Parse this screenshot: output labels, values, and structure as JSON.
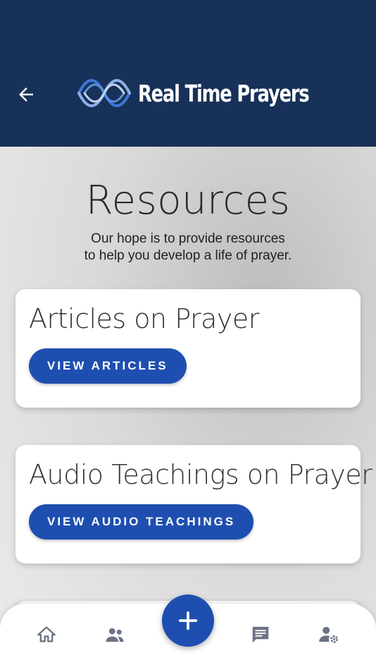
{
  "header": {
    "app_name": "Real Time Prayers",
    "back_icon": "arrow-left-icon",
    "logo_icon": "wave-logo-icon",
    "background_color": "#183158"
  },
  "page": {
    "title": "Resources",
    "subtitle_line1": "Our hope is to provide resources",
    "subtitle_line2": "to help you develop a life of prayer."
  },
  "cards": [
    {
      "title": "Articles on Prayer",
      "button_label": "VIEW ARTICLES"
    },
    {
      "title": "Audio Teachings on Prayer",
      "button_label": "VIEW AUDIO TEACHINGS"
    }
  ],
  "bottom_nav": {
    "items": [
      {
        "icon": "home-icon"
      },
      {
        "icon": "people-icon"
      },
      {
        "icon": "plus-icon"
      },
      {
        "icon": "prayer-list-icon"
      },
      {
        "icon": "user-settings-icon"
      }
    ],
    "accent_color": "#1e4fb0",
    "icon_color": "#6b7385"
  }
}
